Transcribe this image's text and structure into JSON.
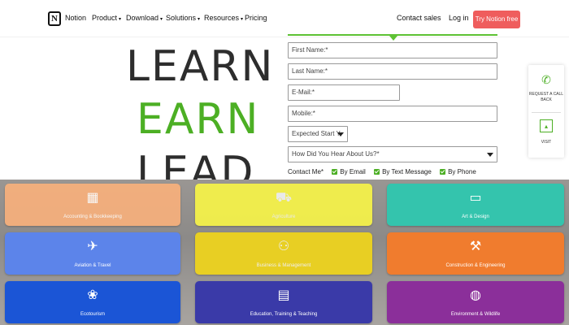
{
  "nav": {
    "brand": "Notion",
    "items": [
      {
        "label": "Product",
        "has_menu": true
      },
      {
        "label": "Download",
        "has_menu": true
      },
      {
        "label": "Solutions",
        "has_menu": true
      },
      {
        "label": "Resources",
        "has_menu": true
      },
      {
        "label": "Pricing",
        "has_menu": false
      }
    ],
    "contact_sales": "Contact sales",
    "login": "Log in",
    "try_free": "Try Notion free",
    "try_color": "#ef5d5d"
  },
  "hero": {
    "line1": "LEARN",
    "line2": "EARN",
    "line3": "LEAD",
    "accent": "#4caf24"
  },
  "form": {
    "first_name": "First Name:*",
    "last_name": "Last Name:*",
    "email": "E-Mail:*",
    "mobile": "Mobile:*",
    "start": "Expected Start Y",
    "hear": "How Did You Hear About Us?*",
    "contact_label": "Contact Me*",
    "options": [
      "By Email",
      "By Text Message",
      "By Phone"
    ]
  },
  "side": {
    "callback": "REQUEST A CALL BACK",
    "callback_icon": "phone-icon",
    "visit": "VISIT",
    "visit_icon": "presentation-icon"
  },
  "categories": [
    {
      "label": "Accounting & Bookkeeping",
      "color": "#f7b07c",
      "icon": "calculator-icon",
      "glyph": "▦"
    },
    {
      "label": "Agriculture",
      "color": "#f4f14a",
      "icon": "tractor-icon",
      "glyph": "⛟"
    },
    {
      "label": "Art & Design",
      "color": "#34c4ad",
      "icon": "monitor-icon",
      "glyph": "▭"
    },
    {
      "label": "Aviation & Travel",
      "color": "#5c84ea",
      "icon": "airplane-icon",
      "glyph": "✈"
    },
    {
      "label": "Business & Management",
      "color": "#e8cf23",
      "icon": "people-icon",
      "glyph": "⚇"
    },
    {
      "label": "Construction & Engineering",
      "color": "#f07c2e",
      "icon": "hammer-icon",
      "glyph": "⚒"
    },
    {
      "label": "Ecotourism",
      "color": "#1b55d6",
      "icon": "eco-icon",
      "glyph": "❀"
    },
    {
      "label": "Education, Training & Teaching",
      "color": "#3a3aa8",
      "icon": "teacher-icon",
      "glyph": "▤"
    },
    {
      "label": "Environment & Wildlife",
      "color": "#8b2f9a",
      "icon": "globe-icon",
      "glyph": "◍"
    }
  ]
}
